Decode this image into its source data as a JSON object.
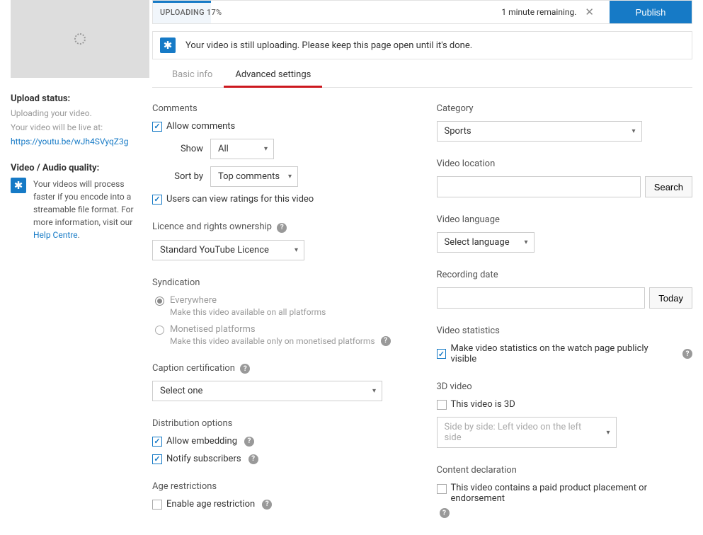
{
  "upload": {
    "progress_text": "UPLOADING 17%",
    "remaining": "1 minute remaining.",
    "publish": "Publish",
    "banner": "Your video is still uploading. Please keep this page open until it's done."
  },
  "tabs": {
    "basic": "Basic info",
    "advanced": "Advanced settings"
  },
  "sidebar": {
    "status_title": "Upload status:",
    "status_text": "Uploading your video.",
    "live_at_label": "Your video will be live at:",
    "live_at_url": "https://youtu.be/wJh4SVyqZ3g",
    "quality_title": "Video / Audio quality:",
    "quality_text": "Your videos will process faster if you encode into a streamable file format. For more information, visit our ",
    "help_centre": "Help Centre"
  },
  "comments": {
    "title": "Comments",
    "allow": "Allow comments",
    "show_label": "Show",
    "show_value": "All",
    "sort_label": "Sort by",
    "sort_value": "Top comments",
    "ratings": "Users can view ratings for this video"
  },
  "licence": {
    "title": "Licence and rights ownership",
    "value": "Standard YouTube Licence"
  },
  "syndication": {
    "title": "Syndication",
    "opt1": "Everywhere",
    "opt1_desc": "Make this video available on all platforms",
    "opt2": "Monetised platforms",
    "opt2_desc": "Make this video available only on monetised platforms"
  },
  "caption": {
    "title": "Caption certification",
    "value": "Select one"
  },
  "distribution": {
    "title": "Distribution options",
    "embed": "Allow embedding",
    "notify": "Notify subscribers"
  },
  "age": {
    "title": "Age restrictions",
    "enable": "Enable age restriction"
  },
  "category": {
    "title": "Category",
    "value": "Sports"
  },
  "location": {
    "title": "Video location",
    "search": "Search"
  },
  "language": {
    "title": "Video language",
    "value": "Select language"
  },
  "recdate": {
    "title": "Recording date",
    "today": "Today"
  },
  "stats": {
    "title": "Video statistics",
    "label": "Make video statistics on the watch page publicly visible"
  },
  "threed": {
    "title": "3D video",
    "label": "This video is 3D",
    "value": "Side by side: Left video on the left side"
  },
  "content": {
    "title": "Content declaration",
    "label": "This video contains a paid product placement or endorsement"
  }
}
